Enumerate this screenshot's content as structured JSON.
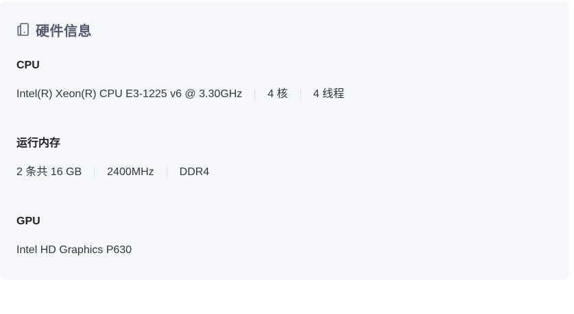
{
  "card": {
    "title": "硬件信息",
    "icon": "device-icon"
  },
  "sections": [
    {
      "title": "CPU",
      "values": [
        "Intel(R) Xeon(R) CPU E3-1225 v6 @ 3.30GHz",
        "4 核",
        "4 线程"
      ]
    },
    {
      "title": "运行内存",
      "values": [
        "2 条共 16 GB",
        "2400MHz",
        "DDR4"
      ]
    },
    {
      "title": "GPU",
      "values": [
        "Intel HD Graphics P630"
      ]
    }
  ]
}
